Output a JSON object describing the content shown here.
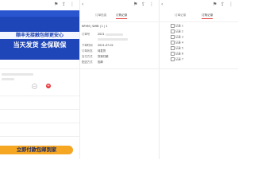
{
  "panel1": {
    "banner_headline1": "顺丰无接触包邮更安心",
    "banner_headline2": "当天发货  全保联保",
    "bottom_bar": "立即付款包邮到家",
    "stepper_minus": "−",
    "stepper_plus": "+"
  },
  "panel2": {
    "tabs": [
      "订单信息",
      "订购记录"
    ],
    "product_line": "NFHM | WHB | 1 | 1",
    "fields": [
      {
        "label": "订单号",
        "value": "2021"
      },
      {
        "label": "下单时间",
        "value": "2021-07-02"
      },
      {
        "label": "订单状态",
        "value": "待发货"
      },
      {
        "label": "支付方式",
        "value": "货到付款"
      },
      {
        "label": "配送方式",
        "value": "包邮"
      }
    ]
  },
  "panel3": {
    "tabs": [
      "订单记录",
      "订购记录"
    ],
    "records": [
      "记录 1",
      "记录 2",
      "记录 3",
      "记录 4",
      "记录 5",
      "记录 6",
      "记录 7"
    ]
  },
  "colors": {
    "banner_blue": "#1f46b8",
    "accent_red": "#e23b3b",
    "bottom_orange": "#f5a623"
  }
}
